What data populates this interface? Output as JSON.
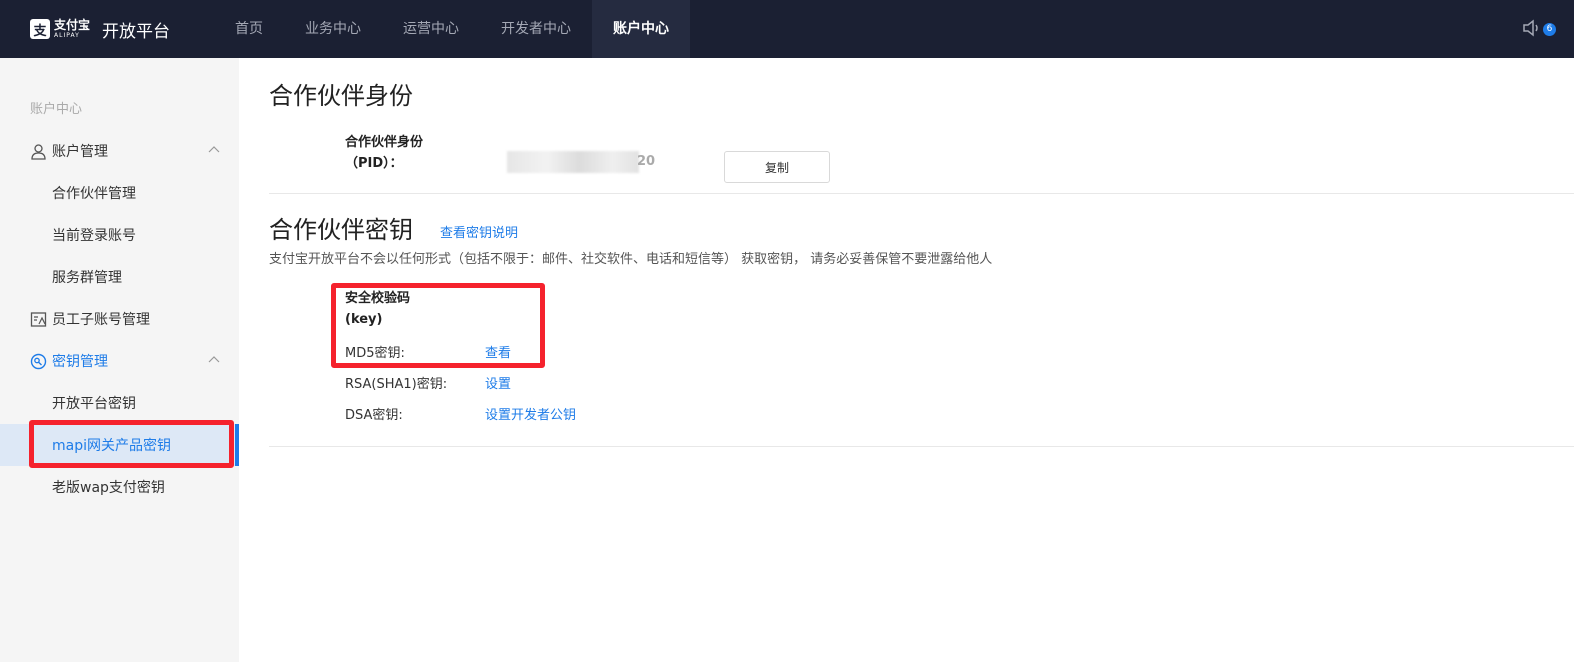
{
  "header": {
    "logo_cn": "支付宝",
    "logo_en": "ALIPAY",
    "title": "开放平台",
    "nav": [
      {
        "label": "首页"
      },
      {
        "label": "业务中心"
      },
      {
        "label": "运营中心"
      },
      {
        "label": "开发者中心"
      },
      {
        "label": "账户中心"
      }
    ],
    "active_nav": "账户中心",
    "notification_count": "6"
  },
  "sidebar": {
    "section_title": "账户中心",
    "items": [
      {
        "label": "账户管理",
        "type": "group",
        "icon": "user-icon",
        "expanded": true
      },
      {
        "label": "合作伙伴管理",
        "type": "sub"
      },
      {
        "label": "当前登录账号",
        "type": "sub"
      },
      {
        "label": "服务群管理",
        "type": "sub"
      },
      {
        "label": "员工子账号管理",
        "type": "group",
        "icon": "staff-icon"
      },
      {
        "label": "密钥管理",
        "type": "group",
        "icon": "key-icon",
        "expanded": true
      },
      {
        "label": "开放平台密钥",
        "type": "sub"
      },
      {
        "label": "mapi网关产品密钥",
        "type": "sub",
        "selected": true
      },
      {
        "label": "老版wap支付密钥",
        "type": "sub"
      }
    ]
  },
  "main": {
    "partner_id_title": "合作伙伴身份",
    "pid_label_line1": "合作伙伴身份",
    "pid_label_line2": "（PID）：",
    "pid_tail": "20",
    "copy_label": "复制",
    "partner_key_title": "合作伙伴密钥",
    "key_help_link": "查看密钥说明",
    "notice": "支付宝开放平台不会以任何形式（包括不限于：邮件、社交软件、电话和短信等） 获取密钥， 请务必妥善保管不要泄露给他人",
    "key_title_line1": "安全校验码",
    "key_title_line2": "(key)",
    "rows": [
      {
        "label": "MD5密钥:",
        "action": "查看"
      },
      {
        "label": "RSA(SHA1)密钥:",
        "action": "设置"
      },
      {
        "label": "DSA密钥:",
        "action": "设置开发者公钥"
      }
    ]
  },
  "colors": {
    "topbar": "#1b2033",
    "accent": "#1e7ce8",
    "highlight": "#f5222d",
    "sidebar_bg": "#f5f5f5"
  }
}
